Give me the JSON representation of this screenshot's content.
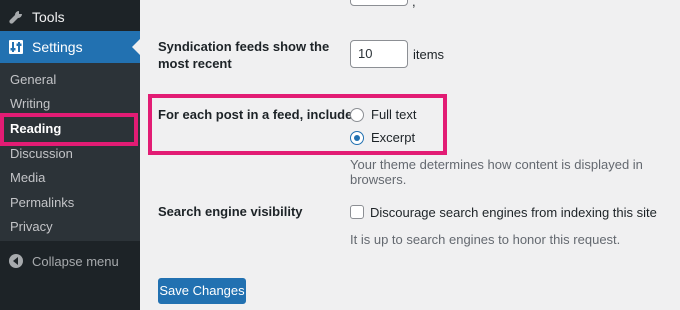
{
  "sidebar": {
    "tools_label": "Tools",
    "settings_label": "Settings",
    "submenu": [
      {
        "label": "General"
      },
      {
        "label": "Writing"
      },
      {
        "label": "Reading"
      },
      {
        "label": "Discussion"
      },
      {
        "label": "Media"
      },
      {
        "label": "Permalinks"
      },
      {
        "label": "Privacy"
      }
    ],
    "current_item": "Reading",
    "collapse_label": "Collapse menu"
  },
  "form": {
    "syndication": {
      "label": "Syndication feeds show the most recent",
      "value": "10",
      "unit": "items"
    },
    "feed_content": {
      "label": "For each post in a feed, include",
      "options": [
        {
          "label": "Full text",
          "checked": false
        },
        {
          "label": "Excerpt",
          "checked": true
        }
      ],
      "description": "Your theme determines how content is displayed in browsers."
    },
    "search_visibility": {
      "label": "Search engine visibility",
      "checkbox_label": "Discourage search engines from indexing this site",
      "checked": false,
      "description": "It is up to search engines to honor this request."
    },
    "save_label": "Save Changes"
  },
  "colors": {
    "sidebar_bg": "#1d2327",
    "submenu_bg": "#2c3338",
    "accent_blue": "#2271b1",
    "highlight": "#e21c74",
    "page_bg": "#f0f0f1"
  },
  "icons": {
    "tools": "wrench-icon",
    "settings": "settings-sliders-icon",
    "collapse": "collapse-arrow-icon"
  }
}
